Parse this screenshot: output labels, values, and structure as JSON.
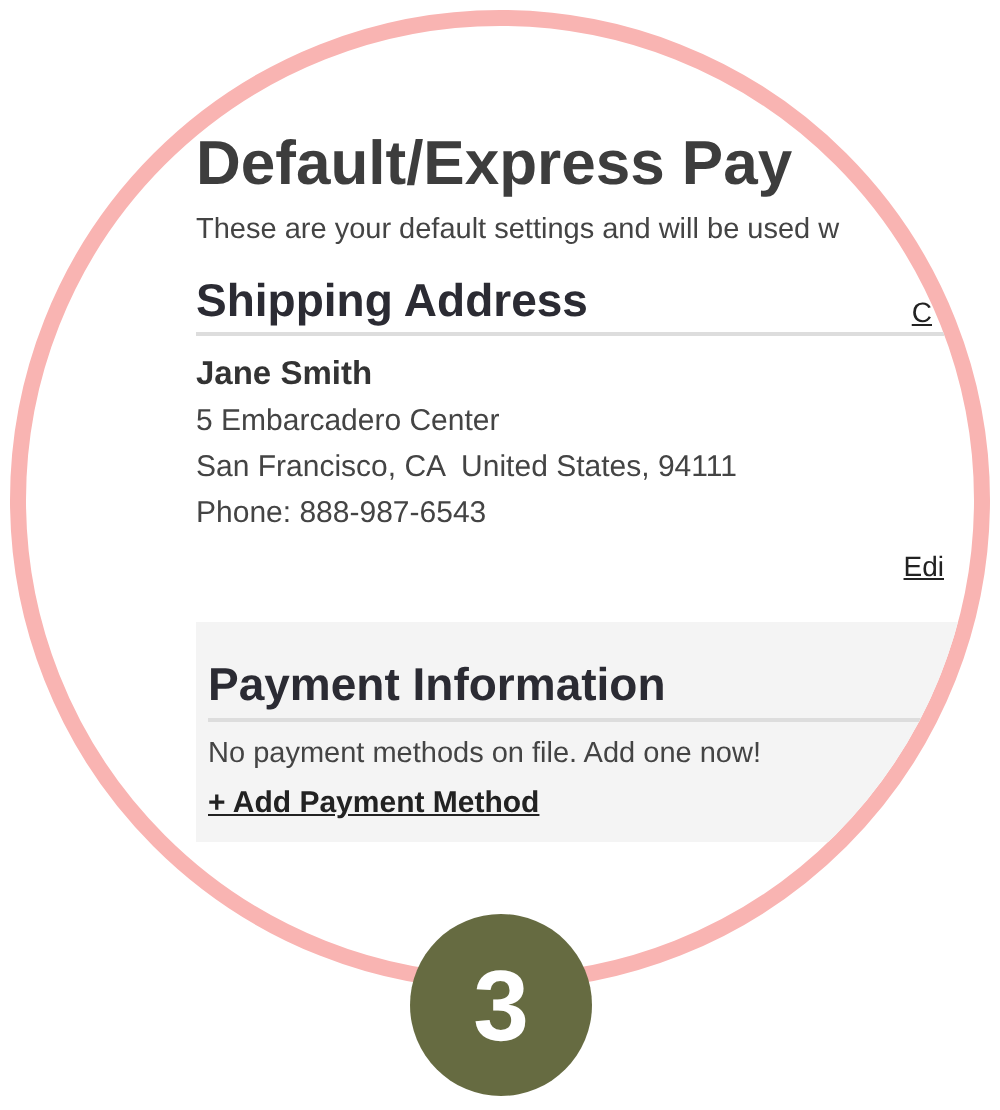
{
  "title": "Default/Express Pay",
  "description": "These are your default settings and will be used w",
  "shipping": {
    "heading": "Shipping Address",
    "header_link": "C",
    "name": "Jane Smith",
    "lines": [
      "5 Embarcadero Center",
      "San Francisco, CA  United States, 94111",
      "Phone: 888-987-6543"
    ],
    "edit_link": "Edi"
  },
  "payment": {
    "heading": "Payment Information",
    "message": "No payment methods on file. Add one now!",
    "add_link": "+ Add Payment Method"
  },
  "step_badge": "3"
}
